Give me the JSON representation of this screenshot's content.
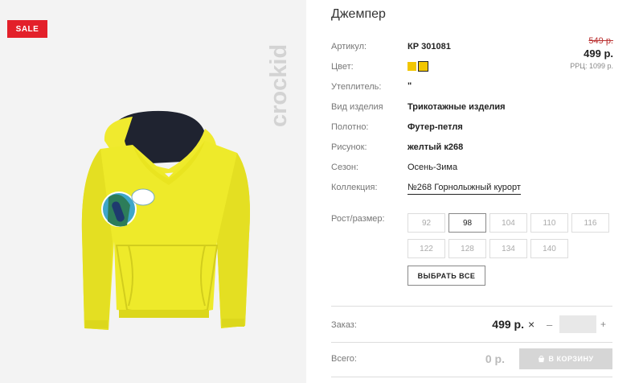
{
  "badge": {
    "label": "SALE"
  },
  "brand": {
    "name": "crockid"
  },
  "product": {
    "title": "Джемпер",
    "attributes": [
      {
        "label": "Артикул:",
        "value": "КР 301081"
      },
      {
        "label": "Цвет:",
        "value": ""
      },
      {
        "label": "Утеплитель:",
        "value": "\""
      },
      {
        "label": "Вид изделия",
        "value": "Трикотажные изделия"
      },
      {
        "label": "Полотно:",
        "value": "Футер-петля"
      },
      {
        "label": "Рисунок:",
        "value": "желтый к268"
      },
      {
        "label": "Сезон:",
        "value": "Осень-Зима"
      },
      {
        "label": "Коллекция:",
        "value": "№268 Горнолыжный курорт"
      }
    ],
    "colors": [
      "#f2c600",
      "#f2c600"
    ]
  },
  "pricing": {
    "old_price": "549 р.",
    "price": "499 р.",
    "rrp": "РРЦ: 1099 р."
  },
  "sizes": {
    "label": "Рост/размер:",
    "options": [
      "92",
      "98",
      "104",
      "110",
      "116",
      "122",
      "128",
      "134",
      "140"
    ],
    "selected": "98",
    "select_all_label": "ВЫБРАТЬ ВСЕ"
  },
  "order": {
    "label": "Заказ:",
    "price": "499 р.",
    "remove_symbol": "×",
    "minus_symbol": "–",
    "plus_symbol": "+",
    "quantity": ""
  },
  "total": {
    "label": "Всего:",
    "value": "0 р.",
    "cart_button_label": "В КОРЗИНУ"
  }
}
